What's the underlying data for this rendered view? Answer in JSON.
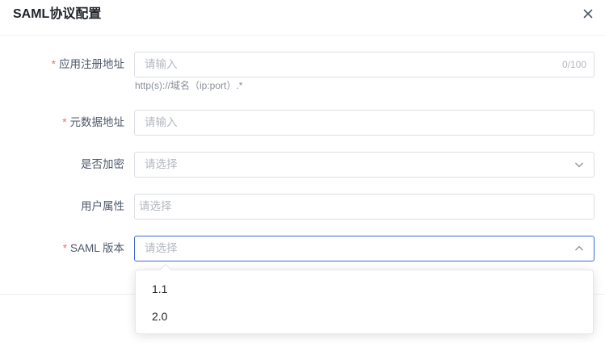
{
  "dialog": {
    "title": "SAML协议配置",
    "close_icon": "close-icon"
  },
  "colors": {
    "required": "#f56c6c",
    "focus_border": "#3a6ad6",
    "border": "#dcdfe6",
    "placeholder": "#b4b8c0"
  },
  "form": {
    "app_register_url": {
      "required_mark": "*",
      "label": "应用注册地址",
      "placeholder": "请输入",
      "counter": "0/100",
      "hint": "http(s)://域名（ip:port）.*"
    },
    "metadata_url": {
      "required_mark": "*",
      "label": "元数据地址",
      "placeholder": "请输入"
    },
    "encrypt": {
      "label": "是否加密",
      "placeholder": "请选择",
      "icon": "chevron-down-icon"
    },
    "user_attributes": {
      "label": "用户属性",
      "placeholder": "请选择"
    },
    "saml_version": {
      "required_mark": "*",
      "label": "SAML 版本",
      "placeholder": "请选择",
      "icon": "chevron-up-icon",
      "options": [
        "1.1",
        "2.0"
      ]
    }
  }
}
